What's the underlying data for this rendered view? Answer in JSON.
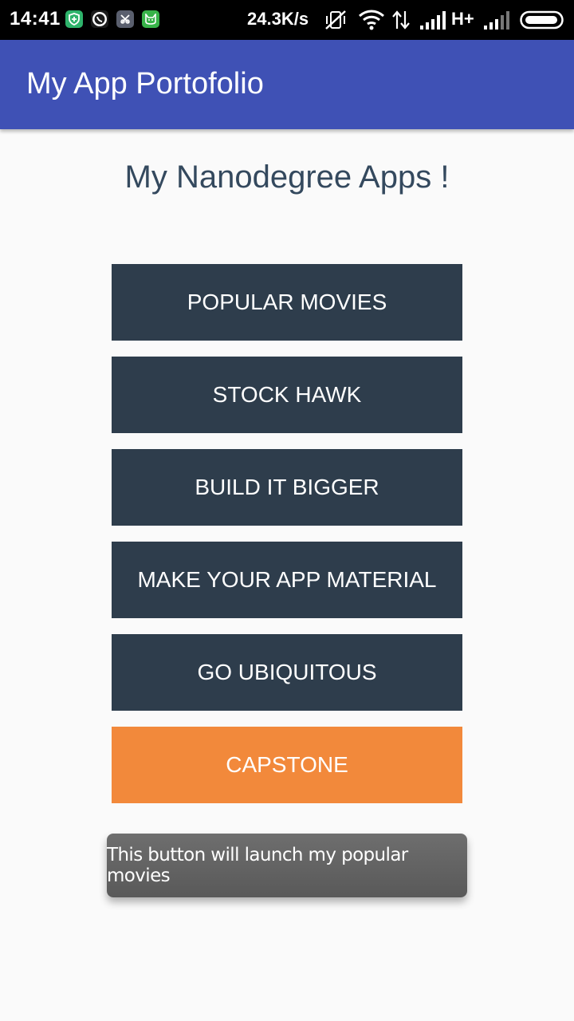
{
  "status_bar": {
    "time": "14:41",
    "net_speed": "24.3K/s",
    "network_type": "H+",
    "notification_icons": [
      "security-shield-icon",
      "whatsapp-icon",
      "clipboard-app-icon",
      "android-cat-icon"
    ],
    "status_icons": [
      "mute-vibrate-icon",
      "wifi-icon",
      "data-transfer-icon",
      "signal-icon",
      "signal-weak-icon",
      "battery-icon"
    ]
  },
  "app_bar": {
    "title": "My App Portofolio",
    "color": "#3f51b5"
  },
  "main": {
    "heading": "My Nanodegree Apps !",
    "buttons": [
      {
        "label": "POPULAR MOVIES",
        "color": "#2e3d4c"
      },
      {
        "label": "STOCK HAWK",
        "color": "#2e3d4c"
      },
      {
        "label": "BUILD IT BIGGER",
        "color": "#2e3d4c"
      },
      {
        "label": "MAKE YOUR APP MATERIAL",
        "color": "#2e3d4c"
      },
      {
        "label": "GO UBIQUITOUS",
        "color": "#2e3d4c"
      },
      {
        "label": "CAPSTONE",
        "color": "#f2893b"
      }
    ]
  },
  "toast": {
    "message": "This button will launch my popular movies"
  }
}
